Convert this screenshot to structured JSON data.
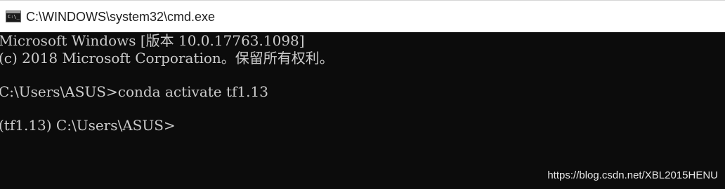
{
  "window": {
    "title": "C:\\WINDOWS\\system32\\cmd.exe",
    "icon": "cmd-console-icon",
    "icon_glyph": "C:\\_"
  },
  "console": {
    "lines": [
      "Microsoft Windows [版本 10.0.17763.1098]",
      "(c) 2018 Microsoft Corporation。保留所有权利。",
      "C:\\Users\\ASUS>conda activate tf1.13",
      "(tf1.13) C:\\Users\\ASUS>"
    ],
    "background_color": "#0c0c0c",
    "text_color": "#cccccc"
  },
  "watermark": {
    "text": "https://blog.csdn.net/XBL2015HENU"
  }
}
